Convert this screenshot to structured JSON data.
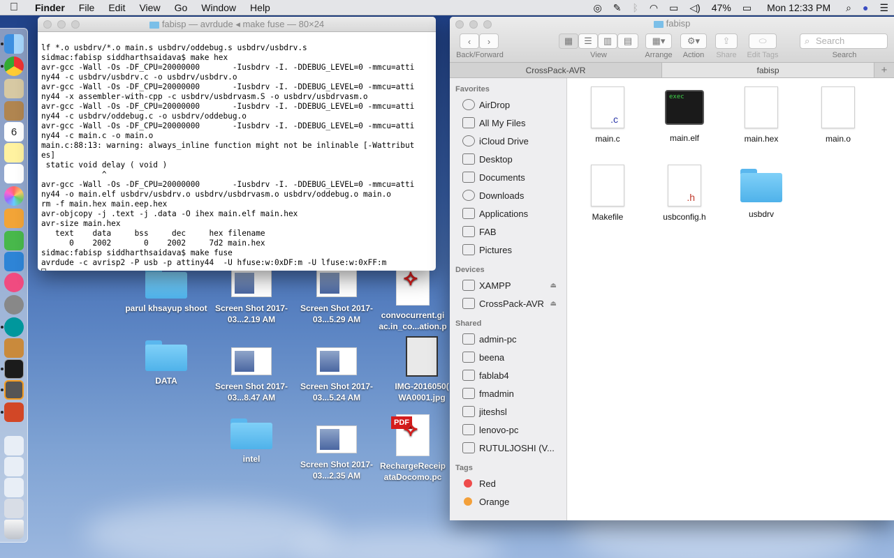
{
  "menubar": {
    "app": "Finder",
    "items": [
      "File",
      "Edit",
      "View",
      "Go",
      "Window",
      "Help"
    ],
    "battery": "47%",
    "clock": "Mon 12:33 PM"
  },
  "terminal": {
    "title": "fabisp — avrdude ◂ make fuse — 80×24",
    "lines": [
      "lf *.o usbdrv/*.o main.s usbdrv/oddebug.s usbdrv/usbdrv.s",
      "sidmac:fabisp siddharthsaidava$ make hex",
      "avr-gcc -Wall -Os -DF_CPU=20000000       -Iusbdrv -I. -DDEBUG_LEVEL=0 -mmcu=atti",
      "ny44 -c usbdrv/usbdrv.c -o usbdrv/usbdrv.o",
      "avr-gcc -Wall -Os -DF_CPU=20000000       -Iusbdrv -I. -DDEBUG_LEVEL=0 -mmcu=atti",
      "ny44 -x assembler-with-cpp -c usbdrv/usbdrvasm.S -o usbdrv/usbdrvasm.o",
      "avr-gcc -Wall -Os -DF_CPU=20000000       -Iusbdrv -I. -DDEBUG_LEVEL=0 -mmcu=atti",
      "ny44 -c usbdrv/oddebug.c -o usbdrv/oddebug.o",
      "avr-gcc -Wall -Os -DF_CPU=20000000       -Iusbdrv -I. -DDEBUG_LEVEL=0 -mmcu=atti",
      "ny44 -c main.c -o main.o",
      "main.c:88:13: warning: always_inline function might not be inlinable [-Wattribut",
      "es]",
      " static void delay ( void )",
      "             ^",
      "avr-gcc -Wall -Os -DF_CPU=20000000       -Iusbdrv -I. -DDEBUG_LEVEL=0 -mmcu=atti",
      "ny44 -o main.elf usbdrv/usbdrv.o usbdrv/usbdrvasm.o usbdrv/oddebug.o main.o",
      "rm -f main.hex main.eep.hex",
      "avr-objcopy -j .text -j .data -O ihex main.elf main.hex",
      "avr-size main.hex",
      "   text    data     bss     dec     hex filename",
      "      0    2002       0    2002     7d2 main.hex",
      "sidmac:fabisp siddharthsaidava$ make fuse",
      "avrdude -c avrisp2 -P usb -p attiny44  -U hfuse:w:0xDF:m -U lfuse:w:0xFF:m"
    ]
  },
  "finder": {
    "title": "fabisp",
    "toolbar": {
      "back_forward": "Back/Forward",
      "view": "View",
      "arrange": "Arrange",
      "action": "Action",
      "share": "Share",
      "edit_tags": "Edit Tags",
      "search_placeholder": "Search",
      "search_label": "Search"
    },
    "tabs": [
      "CrossPack-AVR",
      "fabisp"
    ],
    "sidebar": {
      "favorites_title": "Favorites",
      "favorites": [
        "AirDrop",
        "All My Files",
        "iCloud Drive",
        "Desktop",
        "Documents",
        "Downloads",
        "Applications",
        "FAB",
        "Pictures"
      ],
      "devices_title": "Devices",
      "devices": [
        "XAMPP",
        "CrossPack-AVR"
      ],
      "shared_title": "Shared",
      "shared": [
        "admin-pc",
        "beena",
        "fablab4",
        "fmadmin",
        "jiteshsl",
        "lenovo-pc",
        "RUTULJOSHI (V..."
      ],
      "tags_title": "Tags",
      "tags": [
        {
          "name": "Red",
          "color": "#ee4b4b"
        },
        {
          "name": "Orange",
          "color": "#f3a03a"
        }
      ]
    },
    "files": [
      {
        "name": "main.c",
        "type": "c"
      },
      {
        "name": "main.elf",
        "type": "exec"
      },
      {
        "name": "main.hex",
        "type": "doc"
      },
      {
        "name": "main.o",
        "type": "doc"
      },
      {
        "name": "Makefile",
        "type": "doc"
      },
      {
        "name": "usbconfig.h",
        "type": "h"
      },
      {
        "name": "usbdrv",
        "type": "folder"
      }
    ],
    "exec_label": "exec"
  },
  "desktop": {
    "icons": [
      {
        "label": "parul khsayup shoot",
        "kind": "folder"
      },
      {
        "label": "Screen Shot 2017-03...2.19 AM",
        "kind": "shot"
      },
      {
        "label": "Screen Shot 2017-03...5.29 AM",
        "kind": "shot"
      },
      {
        "label": "convocurrent.gi ac.in_co...ation.p",
        "kind": "pdf"
      },
      {
        "label": "DATA",
        "kind": "folder"
      },
      {
        "label": "Screen Shot 2017-03...8.47 AM",
        "kind": "shot"
      },
      {
        "label": "Screen Shot 2017-03...5.24 AM",
        "kind": "shot"
      },
      {
        "label": "IMG-2016050( WA0001.jpg",
        "kind": "img"
      },
      {
        "label": "intel",
        "kind": "folder"
      },
      {
        "label": "Screen Shot 2017-03...2.35 AM",
        "kind": "shot"
      },
      {
        "label": "RechargeReceip ataDocomo.pc",
        "kind": "pdf"
      }
    ],
    "pdf_badge": "PDF"
  },
  "dock": {
    "calendar_day": "6"
  }
}
